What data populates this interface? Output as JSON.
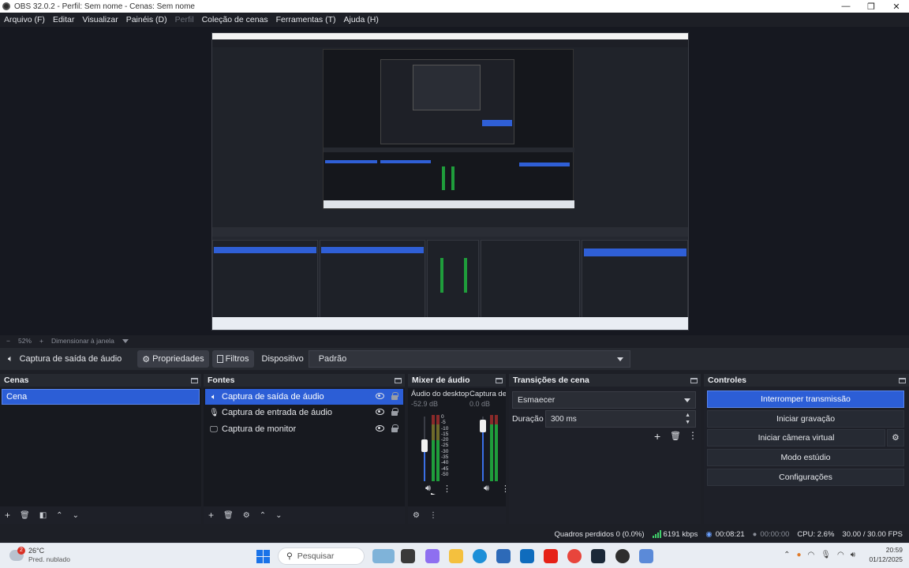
{
  "window": {
    "title": "OBS 32.0.2 - Perfil: Sem nome - Cenas: Sem nome",
    "minimize": "—",
    "maximize": "❐",
    "close": "✕"
  },
  "menu": {
    "items": [
      "Arquivo (F)",
      "Editar",
      "Visualizar",
      "Painéis (D)",
      "Perfil",
      "Coleção de cenas",
      "Ferramentas (T)",
      "Ajuda (H)"
    ]
  },
  "preview_status": {
    "zoom": "52%",
    "mode": "Dimensionar à janela"
  },
  "source_toolbar": {
    "source_name": "Captura de saída de áudio",
    "properties": "Propriedades",
    "filters": "Filtros",
    "device_label": "Dispositivo",
    "device_value": "Padrão"
  },
  "scenes": {
    "title": "Cenas",
    "items": [
      "Cena"
    ]
  },
  "sources": {
    "title": "Fontes",
    "items": [
      {
        "label": "Captura de saída de áudio",
        "icon": "speaker-icon"
      },
      {
        "label": "Captura de entrada de áudio",
        "icon": "microphone-icon"
      },
      {
        "label": "Captura de monitor",
        "icon": "monitor-icon"
      }
    ]
  },
  "mixer": {
    "title": "Mixer de áudio",
    "channels": [
      {
        "name": "Áudio do desktop",
        "db": "-52.9 dB",
        "level": 0.55
      },
      {
        "name": "Captura de e",
        "db": "0.0 dB",
        "level": 0.85
      }
    ],
    "scale": [
      "0",
      "-5",
      "-10",
      "-15",
      "-20",
      "-25",
      "-30",
      "-35",
      "-40",
      "-45",
      "-50",
      "-55",
      "-60"
    ]
  },
  "transitions": {
    "title": "Transições de cena",
    "selected": "Esmaecer",
    "duration_label": "Duração",
    "duration": "300 ms"
  },
  "controls": {
    "title": "Controles",
    "buttons": [
      "Interromper transmissão",
      "Iniciar gravação",
      "Iniciar câmera virtual",
      "Modo estúdio",
      "Configurações"
    ]
  },
  "status": {
    "dropped": "Quadros perdidos 0 (0.0%)",
    "bitrate": "6191 kbps",
    "stream_time": "00:08:21",
    "rec_time": "00:00:00",
    "cpu": "CPU: 2.6%",
    "fps": "30.00 / 30.00 FPS"
  },
  "taskbar": {
    "weather_temp": "26°C",
    "weather_desc": "Pred. nublado",
    "weather_badge": "2",
    "search": "Pesquisar",
    "time": "20:59",
    "date": "01/12/2025"
  },
  "colors": {
    "accent": "#2c5ed6",
    "background": "#1e2028",
    "meter_green": "#1f9d3b"
  }
}
